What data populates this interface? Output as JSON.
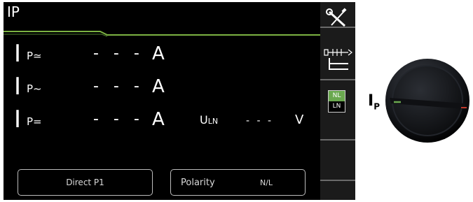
{
  "screen": {
    "title": "IP"
  },
  "rows": [
    {
      "main": "I",
      "sub": "P≃",
      "value": "- - -",
      "unit": "A"
    },
    {
      "main": "I",
      "sub": "P~",
      "value": "- - -",
      "unit": "A"
    },
    {
      "main": "I",
      "sub": "P=",
      "value": "- - -",
      "unit": "A"
    }
  ],
  "uln": {
    "label_main": "U",
    "label_sub": "LN",
    "value": "- - -",
    "unit": "V"
  },
  "buttons": {
    "direct": "Direct P1",
    "polarity_label": "Polarity",
    "polarity_value": "N/L"
  },
  "sidebar": {
    "icons": [
      "settings-tools-icon",
      "probe-connector-icon",
      "nl-ln-toggle-icon"
    ],
    "toggle_top": "NL",
    "toggle_bottom": "LN"
  },
  "dial": {
    "label_main": "I",
    "label_sub": "P"
  },
  "colors": {
    "screen_bg": "#000000",
    "accent_green": "#6aa84f",
    "text": "#ffffff",
    "button_border": "#bdbdbd"
  }
}
